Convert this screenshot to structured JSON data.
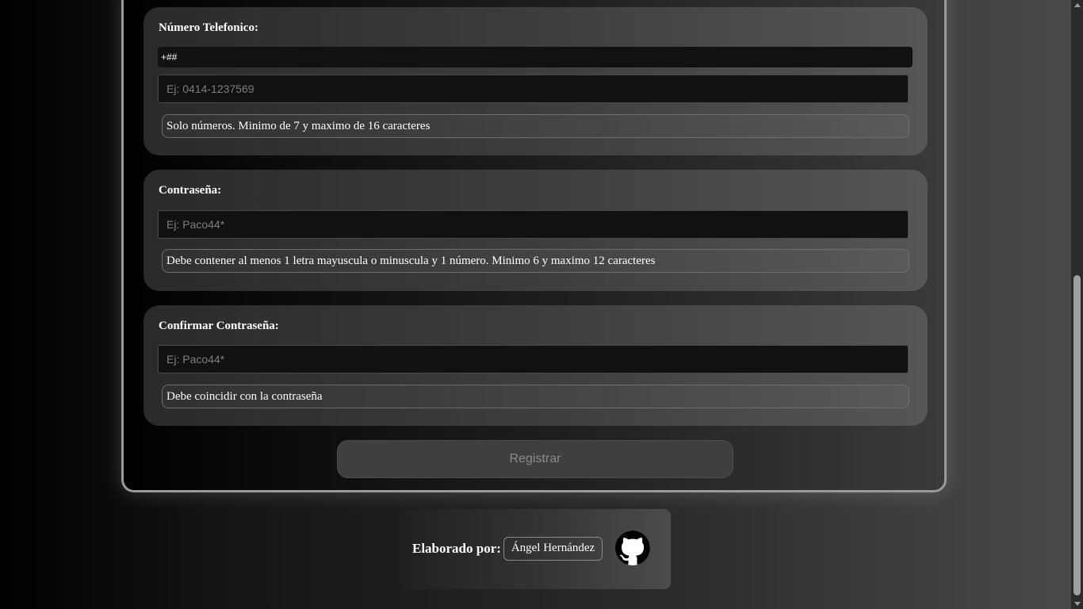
{
  "form": {
    "phone": {
      "label": "Número Telefonico:",
      "prefix_value": "+##",
      "placeholder": "Ej: 0414-1237569",
      "hint": "Solo números. Minimo de 7 y maximo de 16 caracteres"
    },
    "password": {
      "label": "Contraseña:",
      "placeholder": "Ej: Paco44*",
      "hint": "Debe contener al menos 1 letra mayuscula o minuscula y 1 número. Minimo 6 y maximo 12 caracteres"
    },
    "confirm_password": {
      "label": "Confirmar Contraseña:",
      "placeholder": "Ej: Paco44*",
      "hint": "Debe coincidir con la contraseña"
    },
    "submit_label": "Registrar"
  },
  "footer": {
    "label": "Elaborado por:",
    "author": "Ángel Hernández",
    "icon": "github-icon"
  },
  "colors": {
    "input_bg": "#111111",
    "group_bg": "#3d3d3d",
    "button_bg": "#3f3f3f",
    "button_text": "#8a8a8a"
  }
}
